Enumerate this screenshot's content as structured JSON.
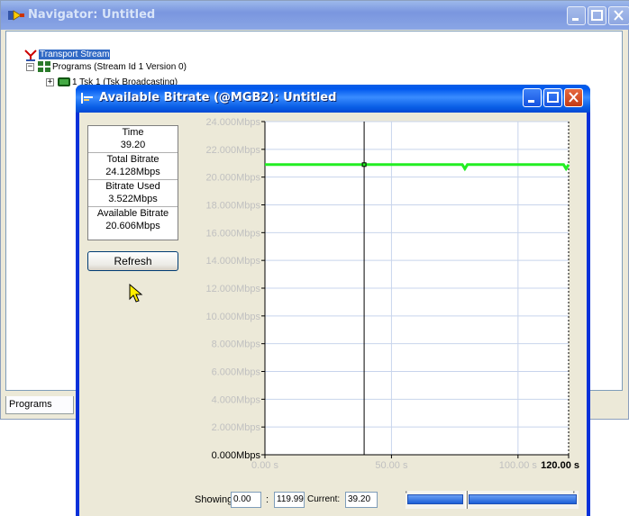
{
  "navigator": {
    "title": "Navigator: Untitled",
    "tree": {
      "root": "Transport Stream",
      "programs": "Programs (Stream Id 1 Version 0)",
      "child": "1 Tsk 1 (Tsk Broadcasting)"
    },
    "tab_label": "Programs"
  },
  "bitrate_window": {
    "title": "Available Bitrate (@MGB2): Untitled",
    "stats": {
      "time_label": "Time",
      "time_value": "39.20",
      "total_label": "Total Bitrate",
      "total_value": "24.128Mbps",
      "used_label": "Bitrate Used",
      "used_value": "3.522Mbps",
      "available_label": "Available Bitrate",
      "available_value": "20.606Mbps"
    },
    "refresh_label": "Refresh",
    "footer": {
      "showing_label": "Showing:",
      "showing_start": "0.00",
      "separator": ":",
      "showing_end": "119.99",
      "current_label": "Current:",
      "current_value": "39.20"
    }
  },
  "chart_data": {
    "type": "line",
    "title": "",
    "xlabel": "",
    "ylabel": "",
    "y_ticks": [
      "0.000Mbps",
      "2.000Mbps",
      "4.000Mbps",
      "6.000Mbps",
      "8.000Mbps",
      "10.000Mbps",
      "12.000Mbps",
      "14.000Mbps",
      "16.000Mbps",
      "18.000Mbps",
      "20.000Mbps",
      "22.000Mbps",
      "24.000Mbps"
    ],
    "y_tick_values": [
      0,
      2,
      4,
      6,
      8,
      10,
      12,
      14,
      16,
      18,
      20,
      22,
      24
    ],
    "x_ticks": [
      "0.00 s",
      "50.00 s",
      "100.00 s",
      "120.00 s"
    ],
    "x_tick_values": [
      0,
      50,
      100,
      120
    ],
    "ylim": [
      0,
      24
    ],
    "xlim": [
      0,
      120
    ],
    "grid": true,
    "cursor_x": 39.2,
    "series": [
      {
        "color": "#22ee22",
        "x": [
          0,
          39.2,
          78,
          79,
          80,
          118,
          119,
          120
        ],
        "y": [
          20.9,
          20.9,
          20.9,
          20.6,
          20.9,
          20.9,
          20.6,
          20.9
        ]
      }
    ]
  },
  "colors": {
    "accent": "#0a5fe6",
    "selection": "#316ac5",
    "series": "#22ee22"
  },
  "icons": {
    "navigator_app": "yellow-arrow-icon",
    "bitrate_app": "chart-window-icon",
    "cursor": "mouse-pointer-icon"
  }
}
